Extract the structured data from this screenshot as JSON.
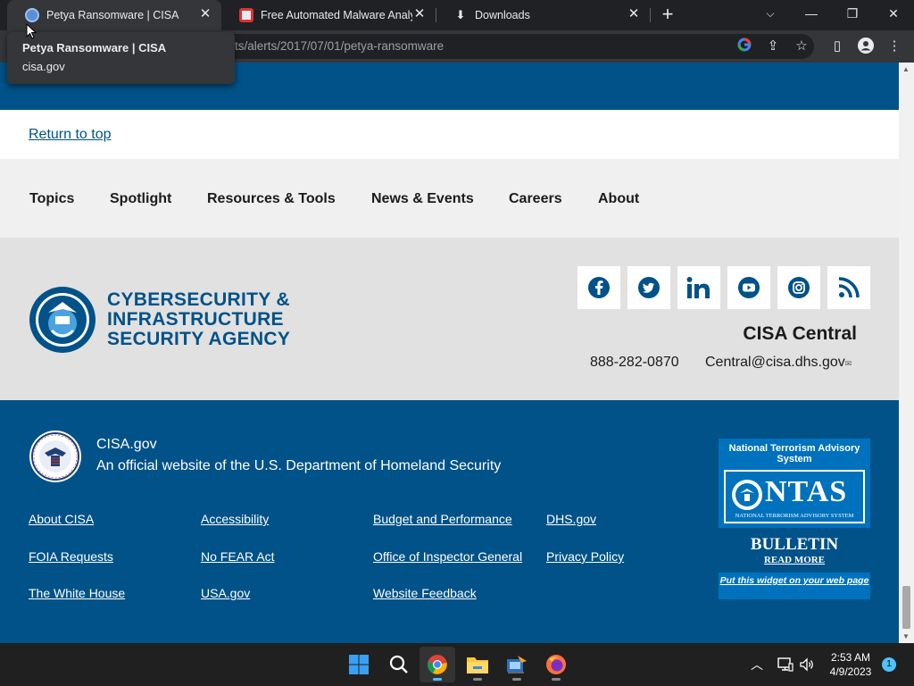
{
  "browser": {
    "tabs": [
      {
        "title": "Petya Ransomware | CISA",
        "active": true
      },
      {
        "title": "Free Automated Malware Analysis",
        "active": false
      },
      {
        "title": "Downloads",
        "active": false
      }
    ],
    "new_tab": "+",
    "url": "ts/alerts/2017/07/01/petya-ransomware",
    "tooltip": {
      "title": "Petya Ransomware | CISA",
      "domain": "cisa.gov"
    }
  },
  "page": {
    "return_to_top": "Return to top",
    "nav": [
      "Topics",
      "Spotlight",
      "Resources & Tools",
      "News & Events",
      "Careers",
      "About"
    ],
    "agency_logo_lines": [
      "CYBERSECURITY &",
      "INFRASTRUCTURE",
      "SECURITY AGENCY"
    ],
    "social": [
      "facebook-icon",
      "twitter-icon",
      "linkedin-icon",
      "youtube-icon",
      "instagram-icon",
      "rss-icon"
    ],
    "central": {
      "title": "CISA Central",
      "phone": "888-282-0870",
      "email": "Central@cisa.dhs.gov"
    },
    "footer": {
      "site": "CISA.gov",
      "official": "An official website of the U.S. Department of Homeland Security",
      "links": [
        [
          "About CISA",
          "FOIA Requests",
          "The White House"
        ],
        [
          "Accessibility",
          "No FEAR Act",
          "USA.gov"
        ],
        [
          "Budget and Performance",
          "Office of Inspector General",
          "Website Feedback"
        ],
        [
          "DHS.gov",
          "Privacy Policy"
        ]
      ]
    },
    "ntas": {
      "title": "National Terrorism Advisory System",
      "word": "NTAS",
      "subtitle": "NATIONAL TERRORISM ADVISORY SYSTEM",
      "bulletin": "BULLETIN",
      "read_more": "READ MORE",
      "widget": "Put this widget on your web page"
    }
  },
  "taskbar": {
    "time": "2:53 AM",
    "date": "4/9/2023",
    "notifications": "1"
  },
  "colors": {
    "cisa_blue": "#005288",
    "nav_bg": "#f0f0f0",
    "mid_bg": "#e1e1e1",
    "ntas_blue": "#0071bc"
  }
}
